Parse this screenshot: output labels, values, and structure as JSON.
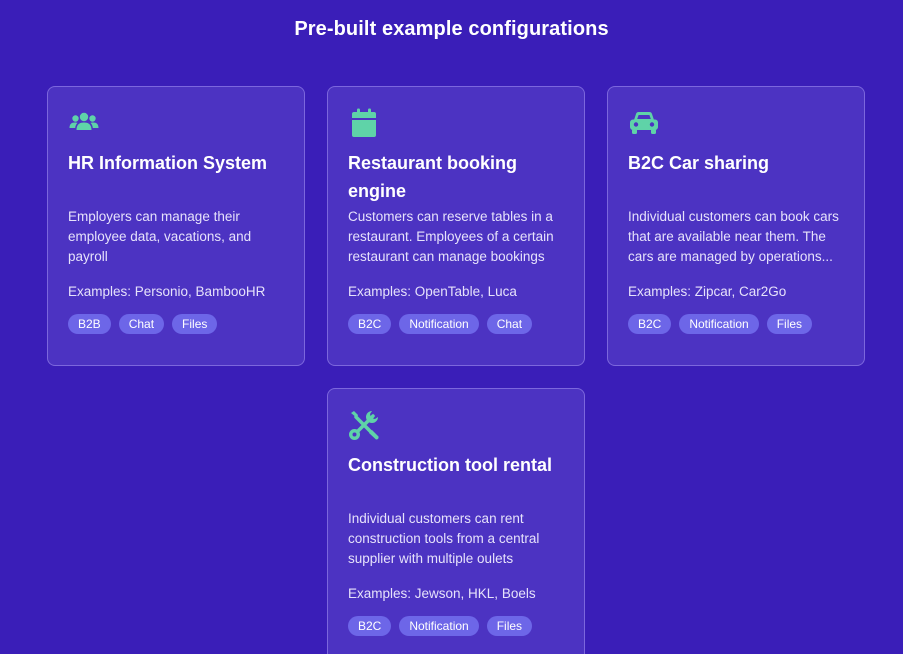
{
  "page": {
    "heading": "Pre-built example configurations"
  },
  "colors": {
    "background": "#3a1eb8",
    "card": "#4c33c2",
    "icon": "#5fd3a8",
    "tag": "#6d66e8"
  },
  "cards": [
    {
      "icon": "users-icon",
      "title": "HR Information System",
      "description": "Employers can manage their employee data, vacations, and payroll",
      "examples": "Examples: Personio, BambooHR",
      "tags": [
        "B2B",
        "Chat",
        "Files"
      ]
    },
    {
      "icon": "calendar-icon",
      "title": "Restaurant booking engine",
      "description": "Customers can reserve tables in a restaurant. Employees of a certain restaurant can manage bookings",
      "examples": "Examples: OpenTable, Luca",
      "tags": [
        "B2C",
        "Notification",
        "Chat"
      ]
    },
    {
      "icon": "car-icon",
      "title": "B2C Car sharing",
      "description": "Individual customers can book cars that are available near them. The cars are managed by operations...",
      "examples": "Examples: Zipcar, Car2Go",
      "tags": [
        "B2C",
        "Notification",
        "Files"
      ]
    },
    {
      "icon": "tools-icon",
      "title": "Construction tool rental",
      "description": "Individual customers can rent construction tools from a central supplier with multiple oulets",
      "examples": "Examples: Jewson, HKL, Boels",
      "tags": [
        "B2C",
        "Notification",
        "Files"
      ]
    }
  ]
}
